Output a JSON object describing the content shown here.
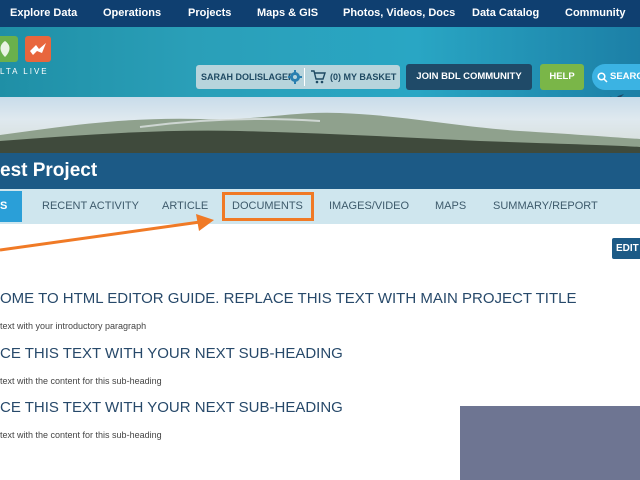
{
  "topnav": {
    "items": [
      "Explore Data",
      "Operations",
      "Projects",
      "Maps & GIS",
      "Photos, Videos, Docs",
      "Data Catalog",
      "Community"
    ]
  },
  "header": {
    "logo_text": "LTA LIVE",
    "user_name": "SARAH DOLISLAGER",
    "basket": "(0) MY BASKET",
    "join_label": "JOIN BDL COMMUNITY",
    "help_label": "HELP",
    "search_label": "SEARCH",
    "icons": [
      "bird-logo-icon",
      "gear-icon",
      "cart-icon",
      "search-icon",
      "back-arrow-icon"
    ]
  },
  "project": {
    "title": "est Project"
  },
  "tabs": {
    "active_label": "S",
    "items": [
      "RECENT ACTIVITY",
      "ARTICLE",
      "DOCUMENTS",
      "IMAGES/VIDEO",
      "MAPS",
      "SUMMARY/REPORT"
    ],
    "highlighted": "DOCUMENTS"
  },
  "content": {
    "edit_label": "EDIT",
    "heading_main": "OME TO HTML EDITOR GUIDE. REPLACE THIS TEXT WITH MAIN PROJECT TITLE",
    "intro_text": "text with your introductory paragraph",
    "sections": [
      {
        "heading": "CE THIS TEXT WITH YOUR NEXT SUB-HEADING",
        "body": "text with the content for this sub-heading"
      },
      {
        "heading": "CE THIS TEXT WITH YOUR NEXT SUB-HEADING",
        "body": "text with the content for this sub-heading"
      }
    ]
  },
  "colors": {
    "nav_bg": "#0f3f70",
    "title_bar": "#1c5a86",
    "active_tab": "#2a9fd8",
    "highlight": "#f07a26",
    "help_green": "#7ab648",
    "search_blue": "#3bb3e3"
  }
}
